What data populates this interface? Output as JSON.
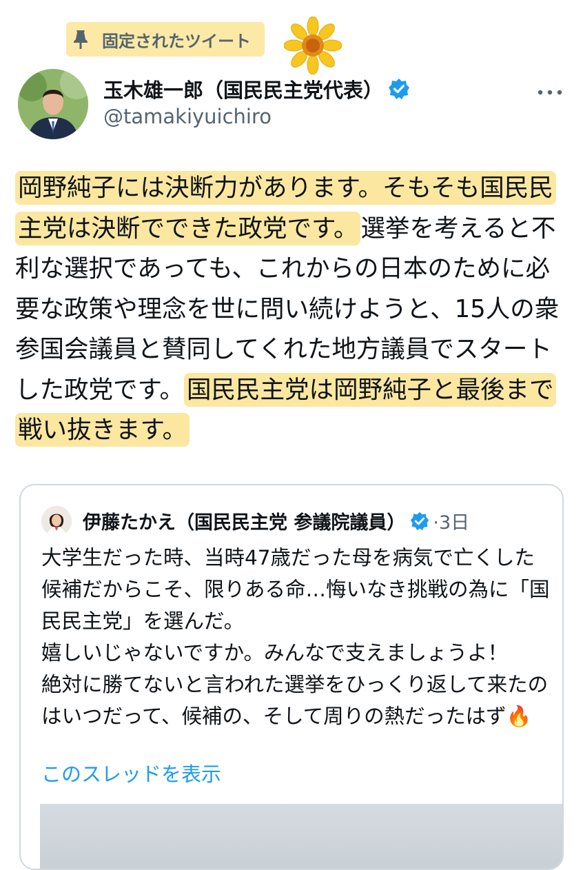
{
  "pinned": {
    "label": "固定されたツイート"
  },
  "tweet": {
    "author_name": "玉木雄一郎（国民民主党代表）",
    "handle": "@tamakiyuichiro",
    "body_segments": [
      {
        "text": "岡野純子には決断力があります。そもそも国民民主党は決断でできた政党です。",
        "highlight": true
      },
      {
        "text": "選挙を考えると不利な選択であっても、これからの日本のために必要な政策や理念を世に問い続けようと、15人の衆参国会議員と賛同してくれた地方議員でスタートした政党です。",
        "highlight": false
      },
      {
        "text": "国民民主党は岡野純子と最後まで戦い抜きます。",
        "highlight": true
      }
    ]
  },
  "quote": {
    "author_name": "伊藤たかえ（国民民主党 参議院議員）",
    "date": "·3日",
    "text": "大学生だった時、当時47歳だった母を病気で亡くした候補だからこそ、限りある命…悔いなき挑戦の為に「国民民主党」を選んだ。\n嬉しいじゃないですか。みんなで支えましょうよ！\n絶対に勝てないと言われた選挙をひっくり返して来たのはいつだって、候補の、そして周りの熱だったはず🔥",
    "show_thread": "このスレッドを表示"
  },
  "colors": {
    "highlight": "#fce7a0",
    "link": "#1d9bf0",
    "secondary_text": "#536471",
    "verified": "#1d9bf0"
  },
  "icons": {
    "pin": "pin-icon",
    "sunflower": "sunflower-icon",
    "verified": "verified-badge-icon",
    "more": "more-options-icon"
  }
}
